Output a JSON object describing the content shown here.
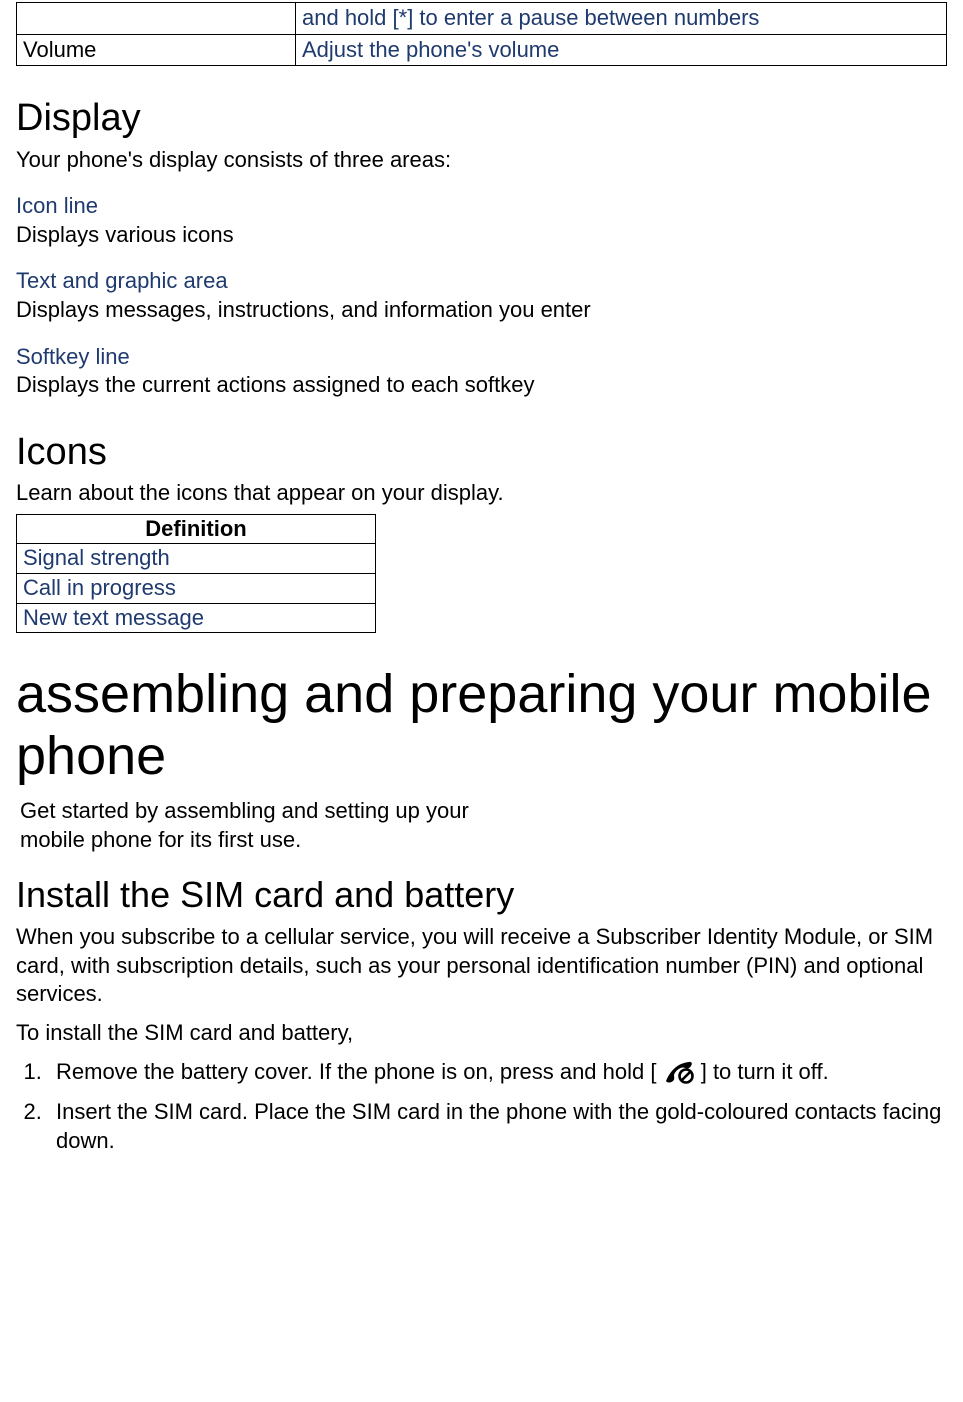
{
  "top_table": {
    "row1": {
      "col1": "",
      "col2": "and hold [*] to enter a pause between numbers"
    },
    "row2": {
      "col1": "Volume",
      "col2": "Adjust the phone's volume"
    }
  },
  "display": {
    "heading": "Display",
    "lead": "Your phone's display consists of three areas:",
    "areas": [
      {
        "title": "Icon line",
        "body": "Displays various icons"
      },
      {
        "title": "Text and graphic area",
        "body": "Displays messages, instructions, and information you enter"
      },
      {
        "title": "Softkey line",
        "body": "Displays the current actions assigned to each softkey"
      }
    ]
  },
  "icons": {
    "heading": "Icons",
    "lead": "Learn about the icons that appear on your display.",
    "def_header": "Definition",
    "defs": [
      "Signal strength",
      "Call in progress",
      "New text message"
    ]
  },
  "chapter": {
    "title": "assembling and preparing your mobile phone",
    "intro": "Get started by assembling and setting up your mobile phone for its first use."
  },
  "install": {
    "heading": "Install the SIM card and battery",
    "p1": "When you subscribe to a cellular service, you will receive a Subscriber Identity Module, or SIM card, with subscription details, such as your personal identification number (PIN) and optional services.",
    "p2": "To install the SIM card and battery,",
    "step1_pre": "Remove the battery cover. If the phone is on, press and hold [",
    "step1_post": "] to turn it off.",
    "step2": "Insert the SIM card. Place the SIM card in the phone with the gold-coloured contacts facing down."
  }
}
